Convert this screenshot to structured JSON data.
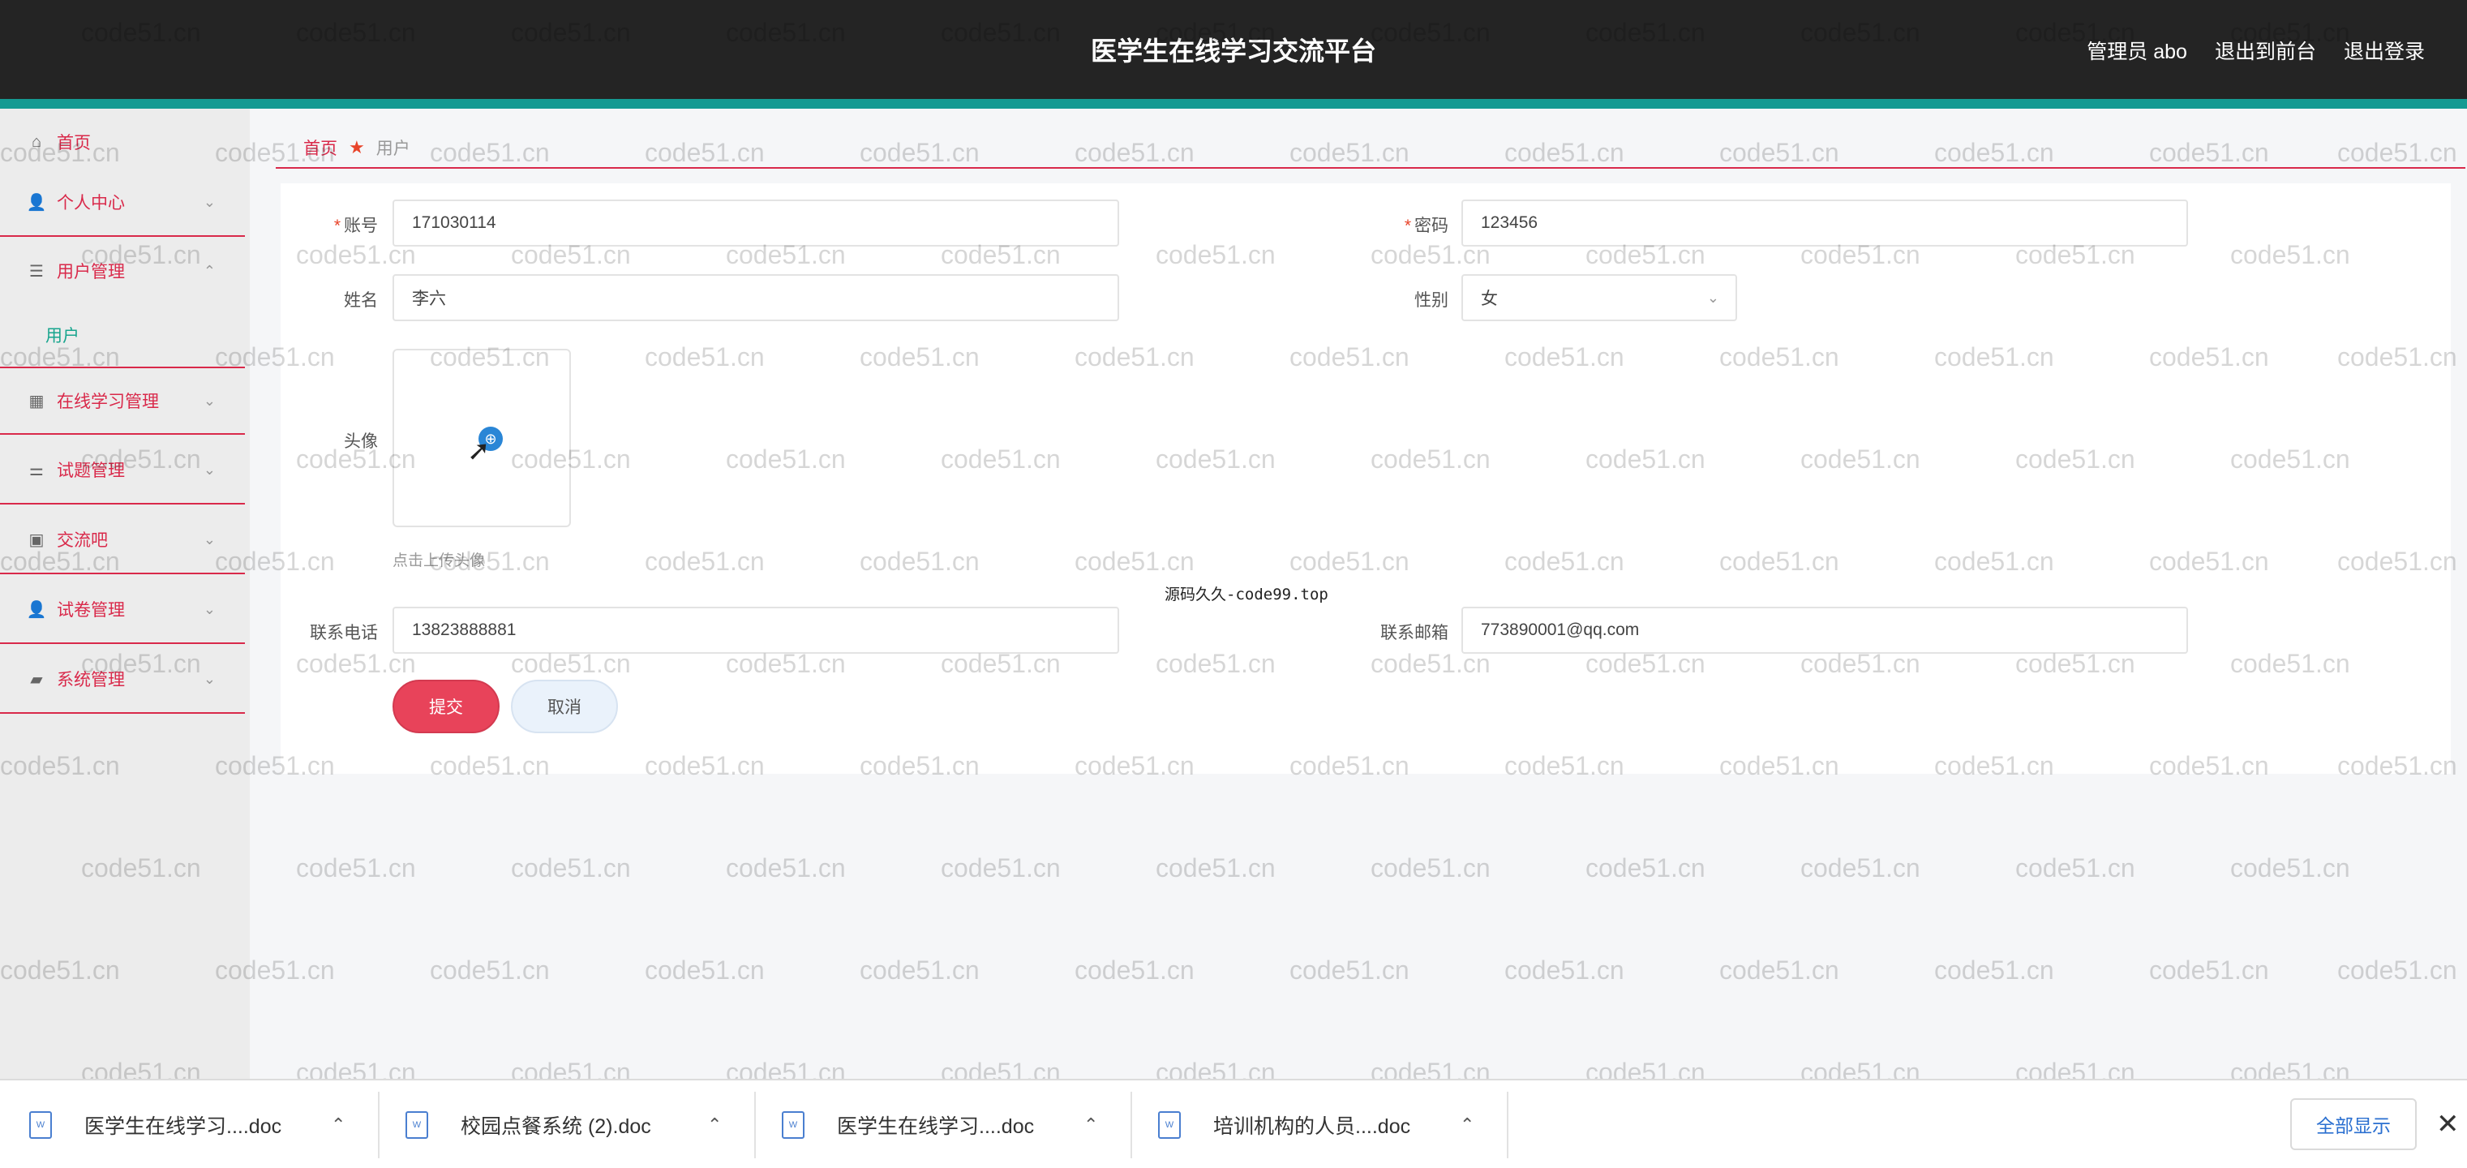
{
  "header": {
    "title": "医学生在线学习交流平台",
    "nav": [
      "管理员 abo",
      "退出到前台",
      "退出登录"
    ]
  },
  "sidebar": {
    "items": [
      {
        "label": "首页",
        "icon": "home-icon"
      },
      {
        "label": "个人中心",
        "icon": "user-icon"
      },
      {
        "label": "用户管理",
        "icon": "list-icon"
      },
      {
        "label": "在线学习管理",
        "icon": "grid-icon"
      },
      {
        "label": "试题管理",
        "icon": "sliders-icon"
      },
      {
        "label": "交流吧",
        "icon": "clipboard-icon"
      },
      {
        "label": "试卷管理",
        "icon": "user-icon"
      },
      {
        "label": "系统管理",
        "icon": "briefcase-icon"
      }
    ],
    "submenu_active": "用户"
  },
  "breadcrumb": {
    "home": "首页",
    "current": "用户"
  },
  "form": {
    "account_label": "账号",
    "account_value": "171030114",
    "password_label": "密码",
    "password_value": "123456",
    "name_label": "姓名",
    "name_value": "李六",
    "gender_label": "性别",
    "gender_value": "女",
    "avatar_label": "头像",
    "avatar_hint": "点击上传头像",
    "phone_label": "联系电话",
    "phone_value": "13823888881",
    "email_label": "联系邮箱",
    "email_value": "773890001@qq.com",
    "submit_label": "提交",
    "cancel_label": "取消"
  },
  "overlay_text": "源码久久-code99.top",
  "watermark": "code51.cn",
  "downloads": {
    "items": [
      "医学生在线学习....doc",
      "校园点餐系统 (2).doc",
      "医学生在线学习....doc",
      "培训机构的人员....doc"
    ],
    "show_all": "全部显示"
  },
  "colors": {
    "header_bg": "#242424",
    "accent_teal": "#159a92",
    "accent_red": "#d9294a",
    "submit_bg": "#e8435a"
  }
}
